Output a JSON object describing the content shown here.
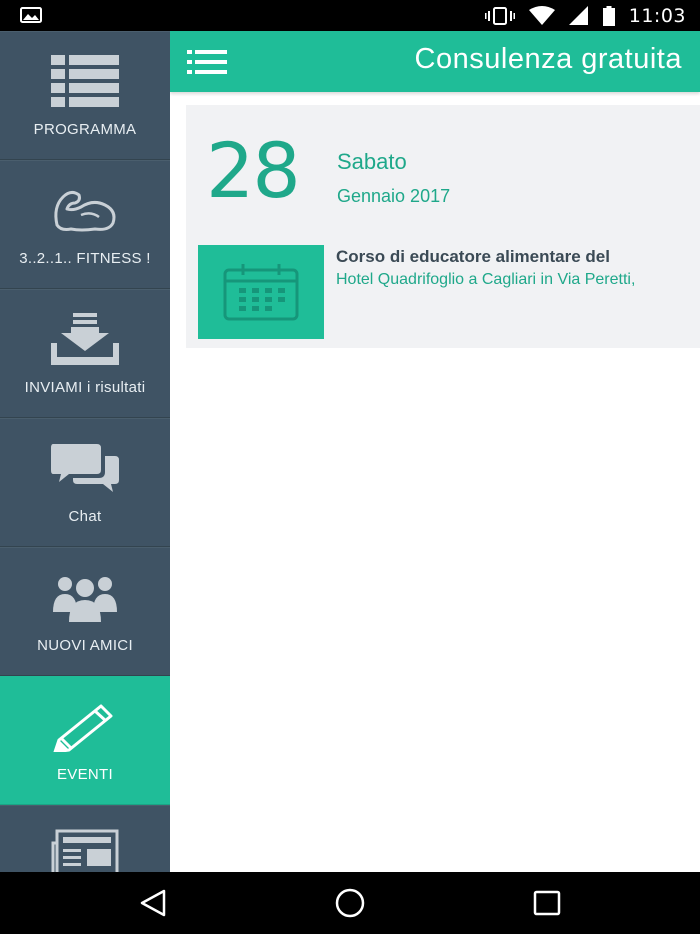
{
  "status_bar": {
    "time": "11:03",
    "icons": [
      "image-notification-icon",
      "vibrate-icon",
      "wifi-icon",
      "signal-icon",
      "battery-icon"
    ]
  },
  "header": {
    "title": "Consulenza gratuita",
    "menu_icon": "list-menu-icon"
  },
  "sidebar": {
    "items": [
      {
        "label": "PROGRAMMA",
        "icon": "list-icon",
        "active": false
      },
      {
        "label": "3..2..1.. FITNESS !",
        "icon": "flexed-arm-icon",
        "active": false
      },
      {
        "label": "INVIAMI i risultati",
        "icon": "download-icon",
        "active": false
      },
      {
        "label": "Chat",
        "icon": "chat-icon",
        "active": false
      },
      {
        "label": "NUOVI AMICI",
        "icon": "group-icon",
        "active": false
      },
      {
        "label": "EVENTI",
        "icon": "pencil-icon",
        "active": true
      },
      {
        "label": "",
        "icon": "newspaper-icon",
        "active": false
      }
    ]
  },
  "event_card": {
    "day": "28",
    "weekday": "Sabato",
    "month_year": "Gennaio 2017",
    "event_title": "Corso di educatore alimentare del",
    "event_place": "Hotel Quadrifoglio a Cagliari in Via Peretti,",
    "thumb_icon": "calendar-icon"
  },
  "nav_bar": {
    "buttons": [
      "back-icon",
      "home-icon",
      "recents-icon"
    ]
  },
  "colors": {
    "accent": "#1fbd98",
    "sidebar_bg": "#3f5364",
    "card_bg": "#f1f2f4",
    "accent_text": "#1fa88a"
  }
}
